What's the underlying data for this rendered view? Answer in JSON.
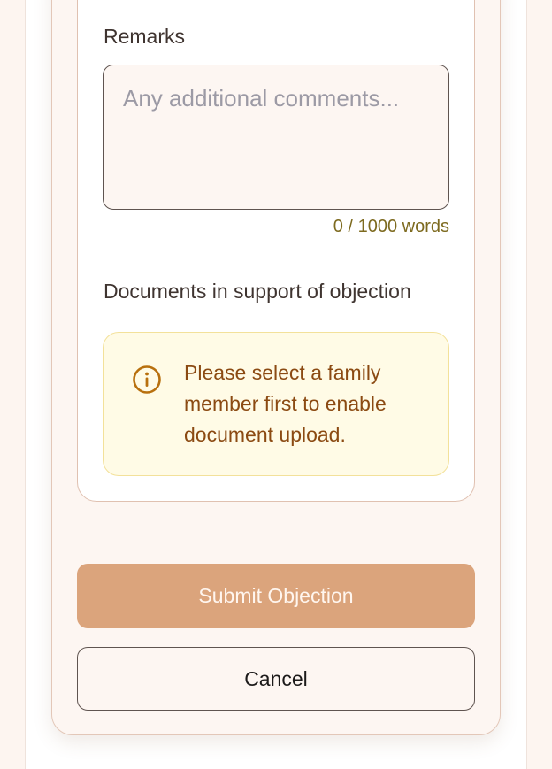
{
  "remarks": {
    "label": "Remarks",
    "value": "",
    "placeholder": "Any additional comments...",
    "word_count": "0 / 1000 words"
  },
  "documents": {
    "label": "Documents in support of objection",
    "notice_icon": "info-circle-icon",
    "notice_text": "Please select a family member first to enable document upload.",
    "notice_color": "#8b4a12",
    "notice_background": "#fffbe6"
  },
  "actions": {
    "submit_label": "Submit Objection",
    "submit_color": "#dba47c",
    "cancel_label": "Cancel"
  }
}
